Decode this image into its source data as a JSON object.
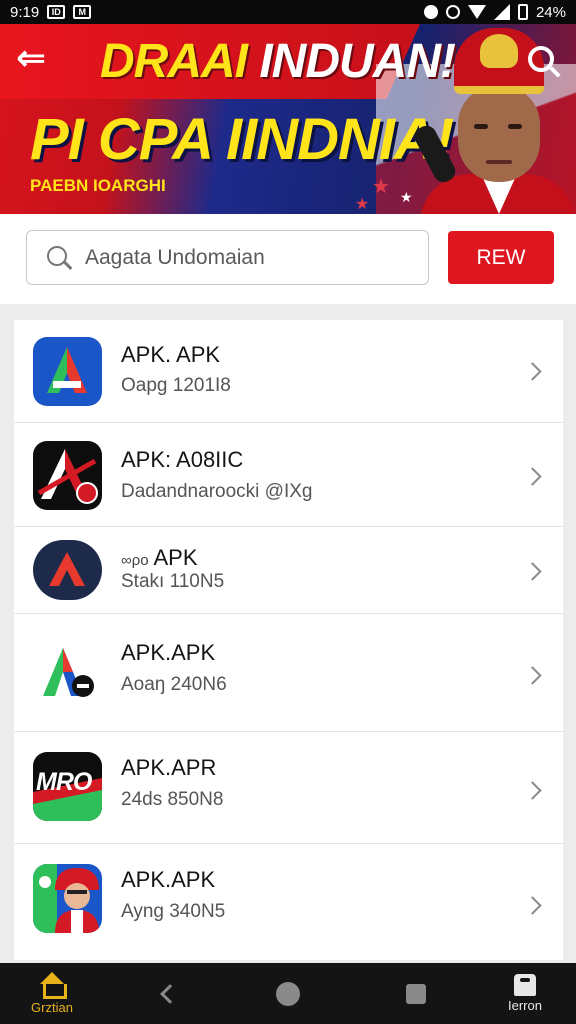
{
  "status_bar": {
    "time": "9:19",
    "battery": "24%"
  },
  "banner": {
    "title_line1_yellow": "DRAAI",
    "title_line1_white": "INDUAN!",
    "title_line2": "PI CPA IINDNIA!",
    "subtitle": "PAEBN IOARGHI",
    "back_icon": "arrow-left-icon",
    "search_icon": "search-icon"
  },
  "search": {
    "placeholder": "Aagata Undomaian",
    "button_label": "REW"
  },
  "apps": [
    {
      "title": "APK. APK",
      "subtitle": "Oapg 1201I8",
      "icon": "app-icon-blue-a"
    },
    {
      "title": "APK: A08IIC",
      "subtitle": "Dadandnaroocki @IXg",
      "icon": "app-icon-black-a"
    },
    {
      "title": "APK",
      "title_prefix": "∞ρo",
      "subtitle": "Stakı 110N5",
      "icon": "app-icon-navy-mountain"
    },
    {
      "title": "APK.APK",
      "subtitle": "Aoaŋ 240N6",
      "icon": "app-icon-white-a"
    },
    {
      "title": "APK.APR",
      "subtitle": "24ds 850N8",
      "icon": "app-icon-mro",
      "icon_text": "MRO"
    },
    {
      "title": "APK.APK",
      "subtitle": "Ayng 340N5",
      "icon": "app-icon-person"
    }
  ],
  "nav": {
    "home_label": "Grztian",
    "profile_label": "Ierron"
  },
  "colors": {
    "accent_red": "#de1620",
    "banner_yellow": "#ffe41a",
    "banner_blue": "#1d2a8a",
    "nav_bg": "#141414",
    "home_gold": "#e8b21a"
  }
}
